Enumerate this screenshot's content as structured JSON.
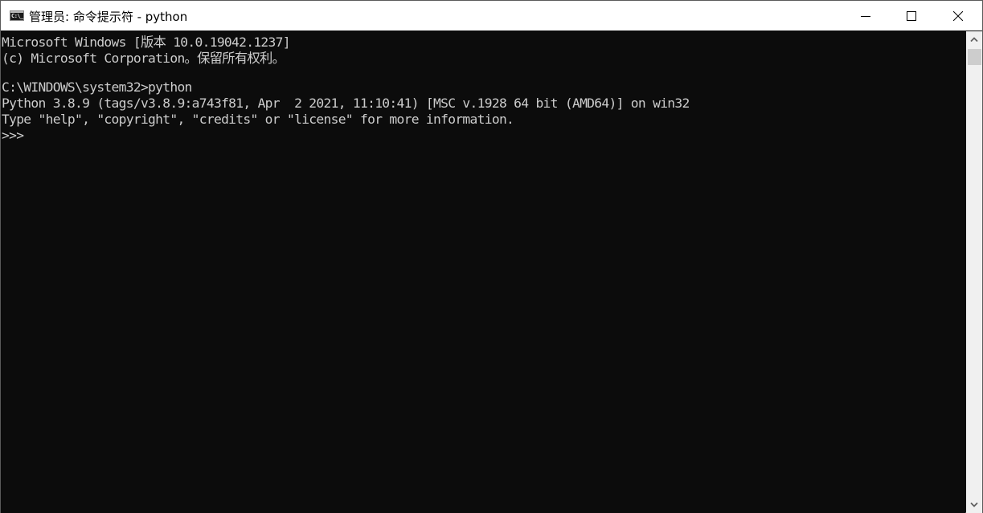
{
  "window": {
    "icon": "console-icon",
    "icon_text": "C:\\_",
    "title": "管理员: 命令提示符 - python",
    "controls": {
      "minimize": "minimize-icon",
      "maximize": "maximize-icon",
      "close": "close-icon"
    }
  },
  "console": {
    "lines": [
      "Microsoft Windows [版本 10.0.19042.1237]",
      "(c) Microsoft Corporation。保留所有权利。",
      "",
      "C:\\WINDOWS\\system32>python",
      "Python 3.8.9 (tags/v3.8.9:a743f81, Apr  2 2021, 11:10:41) [MSC v.1928 64 bit (AMD64)] on win32",
      "Type \"help\", \"copyright\", \"credits\" or \"license\" for more information.",
      ">>> "
    ]
  },
  "scrollbar": {
    "up": "chevron-up-icon",
    "down": "chevron-down-icon"
  },
  "colors": {
    "console_bg": "#0c0c0c",
    "console_fg": "#cccccc",
    "titlebar_bg": "#ffffff",
    "scrollbar_bg": "#f0f0f0"
  }
}
